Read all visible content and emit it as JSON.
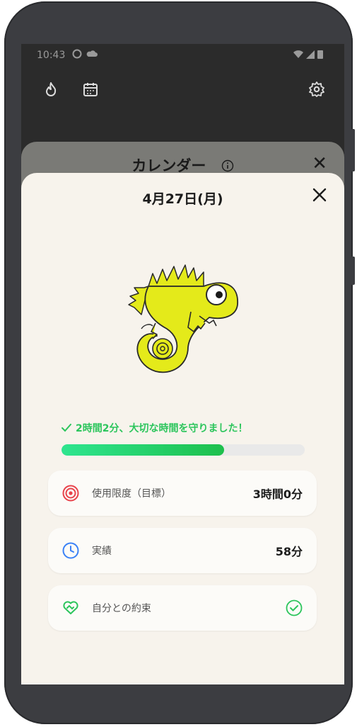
{
  "status_bar": {
    "time": "10:43"
  },
  "back_sheet": {
    "title": "カレンダー",
    "close": "✕"
  },
  "sheet": {
    "date": "4月27日(月)",
    "success_message": "2時間2分、大切な時間を守りました！",
    "progress_fraction": 0.67
  },
  "cards": [
    {
      "label": "使用限度（目標）",
      "value": "3時間0分"
    },
    {
      "label": "実績",
      "value": "58分"
    },
    {
      "label": "自分との約束",
      "value": ""
    }
  ],
  "colors": {
    "accent_green": "#2cc55c",
    "mascot_yellow": "#e4ea1a",
    "target_red": "#e8434b",
    "clock_blue": "#3b82f6"
  }
}
